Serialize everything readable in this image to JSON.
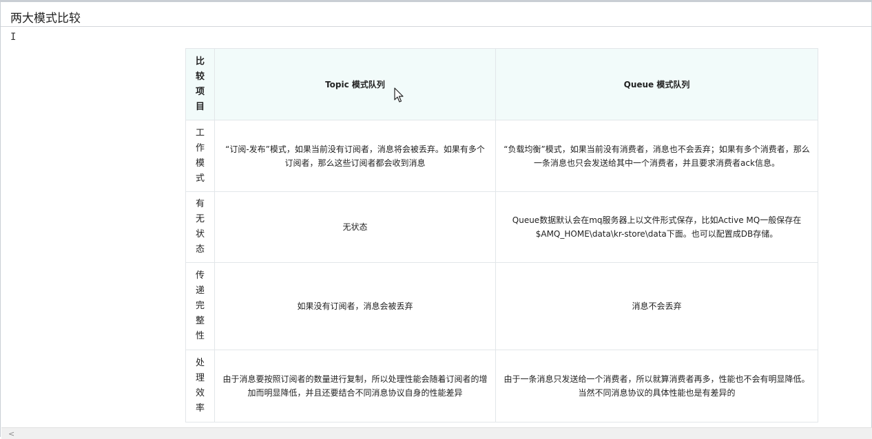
{
  "page": {
    "title": "两大模式比较",
    "caret": "I"
  },
  "table": {
    "headers": [
      "比较项目",
      "Topic 模式队列",
      "Queue 模式队列"
    ],
    "rows": [
      {
        "item": "工作模式",
        "topic": "“订阅-发布”模式，如果当前没有订阅者，消息将会被丢弃。如果有多个订阅者，那么这些订阅者都会收到消息",
        "queue": "“负载均衡”模式，如果当前没有消费者，消息也不会丢弃；如果有多个消费者，那么一条消息也只会发送给其中一个消费者，并且要求消费者ack信息。"
      },
      {
        "item": "有无状态",
        "topic": "无状态",
        "queue": "Queue数据默认会在mq服务器上以文件形式保存，比如Active MQ一般保存在$AMQ_HOME\\data\\kr-store\\data下面。也可以配置成DB存储。"
      },
      {
        "item": "传递完整性",
        "topic": "如果没有订阅者，消息会被丢弃",
        "queue": "消息不会丢弃"
      },
      {
        "item": "处理效率",
        "topic": "由于消息要按照订阅者的数量进行复制，所以处理性能会随着订阅者的增加而明显降低，并且还要结合不同消息协议自身的性能差异",
        "queue": "由于一条消息只发送给一个消费者，所以就算消费者再多，性能也不会有明显降低。当然不同消息协议的具体性能也是有差异的"
      }
    ]
  },
  "icons": {
    "cursor": "mouse-pointer-icon",
    "scroll_left": "chevron-left-icon"
  },
  "scrollbar": {
    "left_arrow": "<"
  }
}
